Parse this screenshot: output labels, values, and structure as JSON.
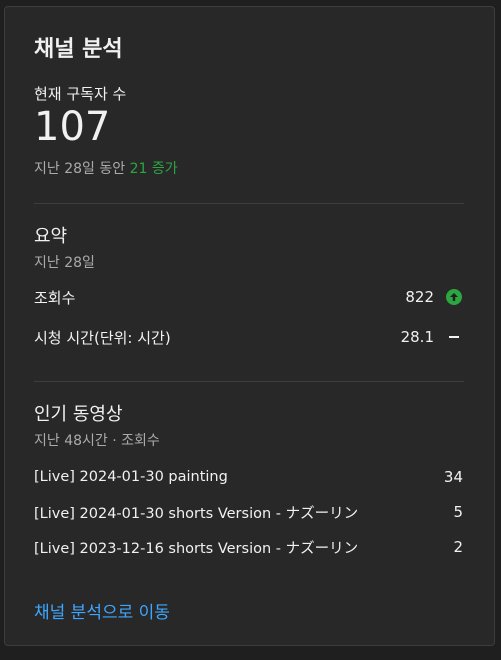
{
  "card": {
    "title": "채널 분석",
    "subscribers": {
      "label": "현재 구독자 수",
      "count": "107",
      "period_prefix": "지난 28일 동안 ",
      "change": "21 증가"
    },
    "summary": {
      "title": "요약",
      "period": "지난 28일",
      "metrics": [
        {
          "label": "조회수",
          "value": "822",
          "trend": "up"
        },
        {
          "label": "시청 시간(단위: 시간)",
          "value": "28.1",
          "trend": "flat"
        }
      ]
    },
    "top_videos": {
      "title": "인기 동영상",
      "period": "지난 48시간 · 조회수",
      "items": [
        {
          "title": "[Live] 2024-01-30 painting",
          "views": "34"
        },
        {
          "title": "[Live] 2024-01-30 shorts Version - ナズーリン",
          "views": "5"
        },
        {
          "title": "[Live] 2023-12-16 shorts Version - ナズーリン",
          "views": "2"
        }
      ]
    },
    "link_label": "채널 분석으로 이동"
  },
  "colors": {
    "background": "#1f1f1f",
    "card": "#282828",
    "accent_green": "#2ba640",
    "link_blue": "#3ea6ff",
    "secondary_text": "#aaaaaa"
  }
}
